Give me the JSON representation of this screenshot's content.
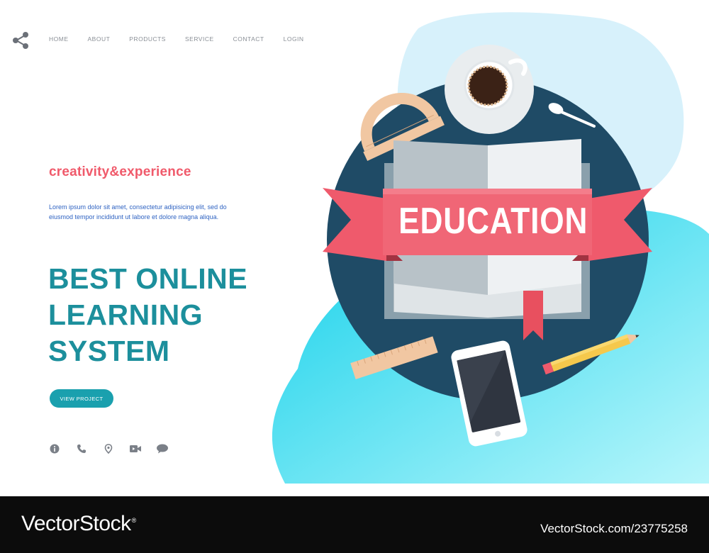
{
  "nav": {
    "items": [
      "HOME",
      "ABOUT",
      "PRODUCTS",
      "SERVICE",
      "CONTACT",
      "LOGIN"
    ]
  },
  "hero": {
    "tagline": "creativity&experience",
    "body": "Lorem ipsum dolor sit amet, consectetur adipisicing elit, sed do eiusmod tempor incididunt ut labore et dolore magna aliqua.",
    "headline_lines": [
      "BEST ONLINE",
      "LEARNING",
      "SYSTEM"
    ],
    "cta_label": "VIEW PROJECT"
  },
  "contact_icons": [
    "info-icon",
    "phone-icon",
    "location-icon",
    "video-icon",
    "chat-icon"
  ],
  "illustration": {
    "banner_text": "EDUCATION"
  },
  "footer": {
    "brand": "VectorStock",
    "brand_mark": "®",
    "stock_id": "VectorStock.com/23775258"
  },
  "colors": {
    "accent_red": "#f05a6b",
    "teal": "#1aa0ae",
    "navy": "#1f4b66",
    "cyan": "#22d5ea"
  }
}
